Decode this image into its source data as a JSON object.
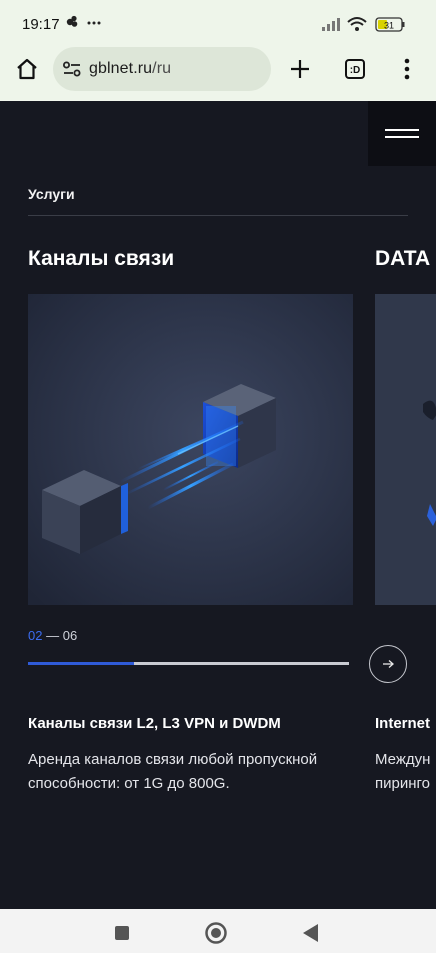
{
  "status_bar": {
    "time": "19:17",
    "more": "···",
    "battery": "31"
  },
  "browser": {
    "url_domain": "gblnet.ru",
    "url_path": "/ru",
    "tabs_label": ":D"
  },
  "page": {
    "section_label": "Услуги",
    "carousel": {
      "current": "02",
      "separator": "—",
      "total": "06",
      "progress": 0.33
    },
    "cards": [
      {
        "title": "Каналы связи",
        "item_title": "Каналы связи L2, L3 VPN и DWDM",
        "description": "Аренда каналов связи любой пропускной способности: от 1G до 800G."
      },
      {
        "title": "DATA",
        "item_title": "Internet",
        "description_line1": "Междун",
        "description_line2": "пиринго"
      }
    ]
  },
  "colors": {
    "page_bg": "#161821",
    "accent": "#3b6cf0",
    "browser_bg": "#eef5ea"
  },
  "icons": {
    "home": "home-icon",
    "site_settings": "tune-icon",
    "new_tab": "plus-icon",
    "tabs": "tab-switcher-icon",
    "menu": "more-vert-icon",
    "hamburger": "hamburger-icon",
    "next": "arrow-right-icon"
  }
}
